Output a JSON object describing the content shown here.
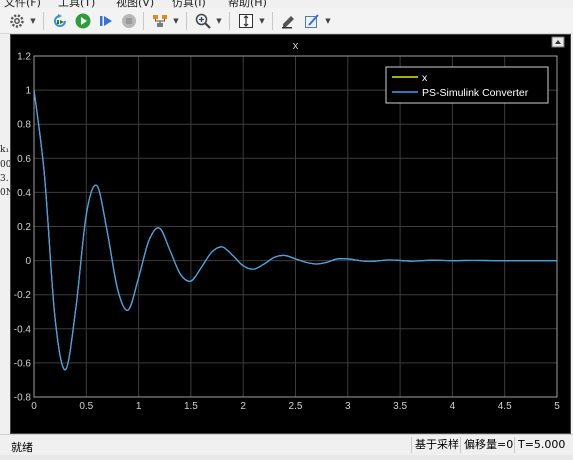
{
  "menu": [
    "文件(F)",
    "工具(T)",
    "视图(V)",
    "仿真(I)",
    "帮助(H)"
  ],
  "toolbar": {
    "icons": [
      "gear-icon",
      "step-back-icon",
      "run-icon",
      "step-forward-icon",
      "stop-icon",
      "signal-selector-icon",
      "zoom-in-icon",
      "autoscale-icon",
      "edit-icon",
      "style-icon"
    ]
  },
  "side_labels": [
    "k₁",
    "00",
    "3.",
    "0N"
  ],
  "scope": {
    "title": "x",
    "background": "#000000",
    "line_colors": {
      "x": "#e5e500",
      "converter": "#3aa0ff"
    }
  },
  "chart_data": {
    "type": "line",
    "title": "x",
    "xlim": [
      0,
      5
    ],
    "ylim": [
      -0.8,
      1.2
    ],
    "xticks": [
      0,
      0.5,
      1,
      1.5,
      2,
      2.5,
      3,
      3.5,
      4,
      4.5,
      5
    ],
    "yticks": [
      -0.8,
      -0.6,
      -0.4,
      -0.2,
      0,
      0.2,
      0.4,
      0.6,
      0.8,
      1,
      1.2
    ],
    "tick_labels_x": [
      "0",
      "0.5",
      "1",
      "1.5",
      "2",
      "2.5",
      "3",
      "3.5",
      "4",
      "4.5",
      "5"
    ],
    "tick_labels_y": [
      "-0.8",
      "-0.6",
      "-0.4",
      "-0.2",
      "0",
      "0.2",
      "0.4",
      "0.6",
      "0.8",
      "1",
      "1.2"
    ],
    "grid": true,
    "legend_position": "top-right",
    "series": [
      {
        "name": "x",
        "x": [
          0,
          0.1,
          0.2,
          0.3,
          0.4,
          0.5,
          0.6,
          0.7,
          0.8,
          0.9,
          1.0,
          1.1,
          1.2,
          1.3,
          1.4,
          1.5,
          1.6,
          1.7,
          1.8,
          1.9,
          2.0,
          2.1,
          2.2,
          2.3,
          2.4,
          2.5,
          2.6,
          2.7,
          2.8,
          2.9,
          3.0,
          3.2,
          3.4,
          3.6,
          3.8,
          4.0,
          4.2,
          4.4,
          4.6,
          4.8,
          5.0
        ],
        "y": [
          1.0,
          0.5,
          -0.33,
          -0.64,
          -0.28,
          0.27,
          0.44,
          0.17,
          -0.17,
          -0.29,
          -0.1,
          0.12,
          0.19,
          0.06,
          -0.08,
          -0.12,
          -0.04,
          0.05,
          0.08,
          0.03,
          -0.03,
          -0.05,
          -0.02,
          0.02,
          0.03,
          0.01,
          -0.01,
          -0.02,
          -0.01,
          0.01,
          0.01,
          -0.005,
          0.004,
          -0.003,
          0.002,
          0.0,
          0.001,
          0.0,
          0.0,
          0.0,
          0.0
        ]
      },
      {
        "name": "PS-Simulink Converter",
        "x": [
          0,
          0.1,
          0.2,
          0.3,
          0.4,
          0.5,
          0.6,
          0.7,
          0.8,
          0.9,
          1.0,
          1.1,
          1.2,
          1.3,
          1.4,
          1.5,
          1.6,
          1.7,
          1.8,
          1.9,
          2.0,
          2.1,
          2.2,
          2.3,
          2.4,
          2.5,
          2.6,
          2.7,
          2.8,
          2.9,
          3.0,
          3.2,
          3.4,
          3.6,
          3.8,
          4.0,
          4.2,
          4.4,
          4.6,
          4.8,
          5.0
        ],
        "y": [
          1.0,
          0.5,
          -0.33,
          -0.64,
          -0.28,
          0.27,
          0.44,
          0.17,
          -0.17,
          -0.29,
          -0.1,
          0.12,
          0.19,
          0.06,
          -0.08,
          -0.12,
          -0.04,
          0.05,
          0.08,
          0.03,
          -0.03,
          -0.05,
          -0.02,
          0.02,
          0.03,
          0.01,
          -0.01,
          -0.02,
          -0.01,
          0.01,
          0.01,
          -0.005,
          0.004,
          -0.003,
          0.002,
          0.0,
          0.001,
          0.0,
          0.0,
          0.0,
          0.0
        ]
      }
    ]
  },
  "status": {
    "left": "就绪",
    "mode": "基于采样",
    "offset": "偏移量=0",
    "time": "T=5.000"
  }
}
